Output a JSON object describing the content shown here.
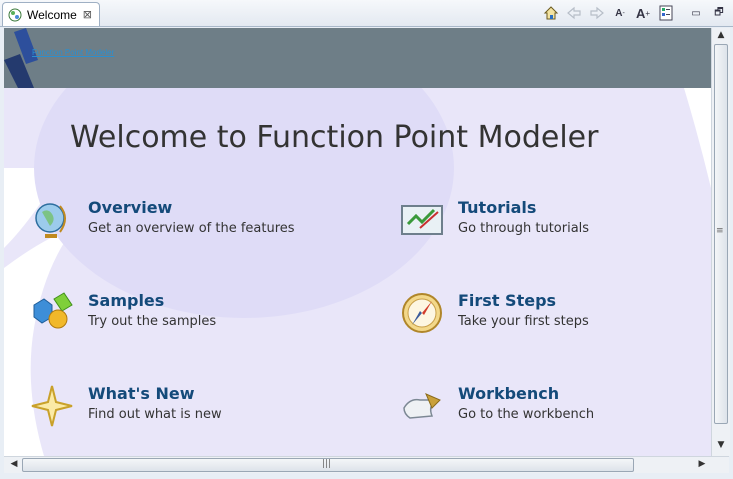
{
  "tab": {
    "label": "Welcome",
    "close_glyph": "⊠"
  },
  "toolbar": {
    "home": "home-icon",
    "back": "back-arrow-icon",
    "forward": "forward-arrow-icon",
    "font_down": "A",
    "font_up": "A",
    "customize": "customize-page-icon",
    "minimize": "▭",
    "maximize": "🗗"
  },
  "banner": {
    "logo_text": "Function Point Modeler"
  },
  "page": {
    "title": "Welcome to Function Point Modeler"
  },
  "items": [
    {
      "heading": "Overview",
      "description": "Get an overview of the features",
      "icon": "globe-icon"
    },
    {
      "heading": "Tutorials",
      "description": "Go through tutorials",
      "icon": "tutorial-board-icon"
    },
    {
      "heading": "Samples",
      "description": "Try out the samples",
      "icon": "shapes-icon"
    },
    {
      "heading": "First Steps",
      "description": "Take your first steps",
      "icon": "compass-icon"
    },
    {
      "heading": "What's New",
      "description": "Find out what is new",
      "icon": "star-icon"
    },
    {
      "heading": "Workbench",
      "description": "Go to the workbench",
      "icon": "workbench-icon"
    }
  ],
  "scroll": {
    "up": "▲",
    "down": "▼",
    "left": "◀",
    "right": "▶",
    "v_grip": "≡",
    "h_grip": "|||"
  },
  "colors": {
    "banner": "#6e7e87",
    "heading": "#144a7a",
    "background": "#e8e6f8"
  }
}
